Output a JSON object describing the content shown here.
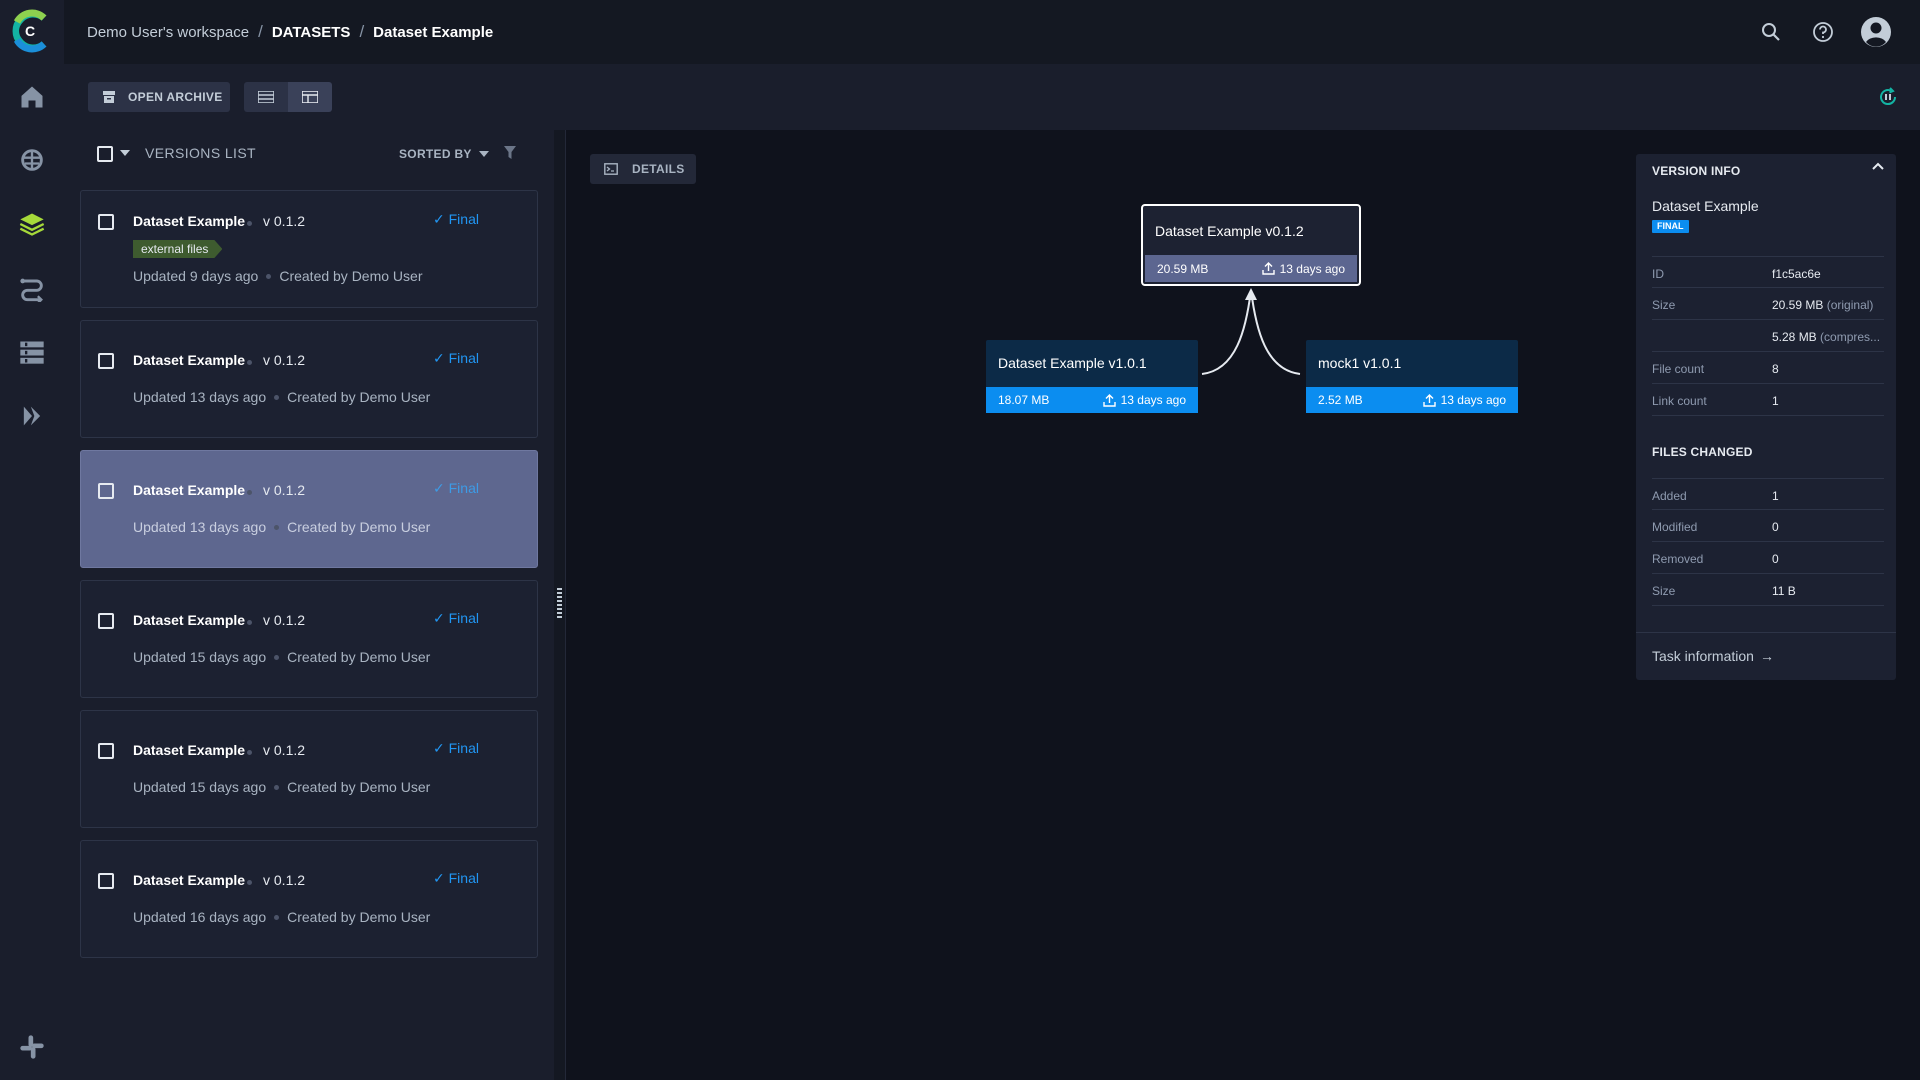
{
  "header": {
    "workspace": "Demo User's workspace",
    "section": "DATASETS",
    "page": "Dataset Example",
    "separator": "/"
  },
  "toolbar": {
    "open_archive_label": "OPEN ARCHIVE"
  },
  "list": {
    "title": "VERSIONS LIST",
    "sorted_by_label": "SORTED BY",
    "items": [
      {
        "name": "Dataset Example",
        "version": "v 0.1.2",
        "status": "Final",
        "tag": "external files",
        "updated": "Updated 9 days ago",
        "creator": "Created by Demo User"
      },
      {
        "name": "Dataset Example",
        "version": "v 0.1.2",
        "status": "Final",
        "updated": "Updated 13 days ago",
        "creator": "Created by Demo User"
      },
      {
        "name": "Dataset Example",
        "version": "v 0.1.2",
        "status": "Final",
        "updated": "Updated 13 days ago",
        "creator": "Created by Demo User",
        "selected": true
      },
      {
        "name": "Dataset Example",
        "version": "v 0.1.2",
        "status": "Final",
        "updated": "Updated 15 days ago",
        "creator": "Created by Demo User"
      },
      {
        "name": "Dataset Example",
        "version": "v 0.1.2",
        "status": "Final",
        "updated": "Updated 15 days ago",
        "creator": "Created by Demo User"
      },
      {
        "name": "Dataset Example",
        "version": "v 0.1.2",
        "status": "Final",
        "updated": "Updated 16 days ago",
        "creator": "Created by Demo User"
      }
    ]
  },
  "canvas": {
    "details_label": "DETAILS",
    "nodes": {
      "main": {
        "title": "Dataset Example v0.1.2",
        "size": "20.59 MB",
        "time": "13 days ago"
      },
      "parent_a": {
        "title": "Dataset Example v1.0.1",
        "size": "18.07 MB",
        "time": "13 days ago"
      },
      "parent_b": {
        "title": "mock1 v1.0.1",
        "size": "2.52 MB",
        "time": "13 days ago"
      }
    }
  },
  "info": {
    "title": "VERSION INFO",
    "dataset_name": "Dataset Example",
    "badge": "FINAL",
    "id_label": "ID",
    "id_value": "f1c5ac6e",
    "size_label": "Size",
    "size_original": "20.59 MB",
    "size_original_note": "(original)",
    "size_compressed": "5.28 MB",
    "size_compressed_note": "(compres...",
    "file_count_label": "File count",
    "file_count": "8",
    "link_count_label": "Link count",
    "link_count": "1",
    "files_changed_title": "FILES CHANGED",
    "added_label": "Added",
    "added": "1",
    "modified_label": "Modified",
    "modified": "0",
    "removed_label": "Removed",
    "removed": "0",
    "changed_size_label": "Size",
    "changed_size": "11 B",
    "task_link": "Task information",
    "task_arrow": "→"
  },
  "colors": {
    "accent": "#0b8df0",
    "final_text": "#2196f3",
    "selected_card": "#5e678f",
    "tag_green": "#3e5b2f"
  },
  "icons": [
    "home-icon",
    "brain-icon",
    "layers-icon",
    "pipelines-icon",
    "reports-icon",
    "deploy-icon",
    "slack-icon",
    "search-icon",
    "help-icon",
    "user-avatar-icon",
    "archive-icon",
    "list-view-icon",
    "details-view-icon",
    "refresh-icon",
    "filter-icon",
    "upload-icon",
    "chevron-up-icon",
    "arrow-right-icon"
  ]
}
